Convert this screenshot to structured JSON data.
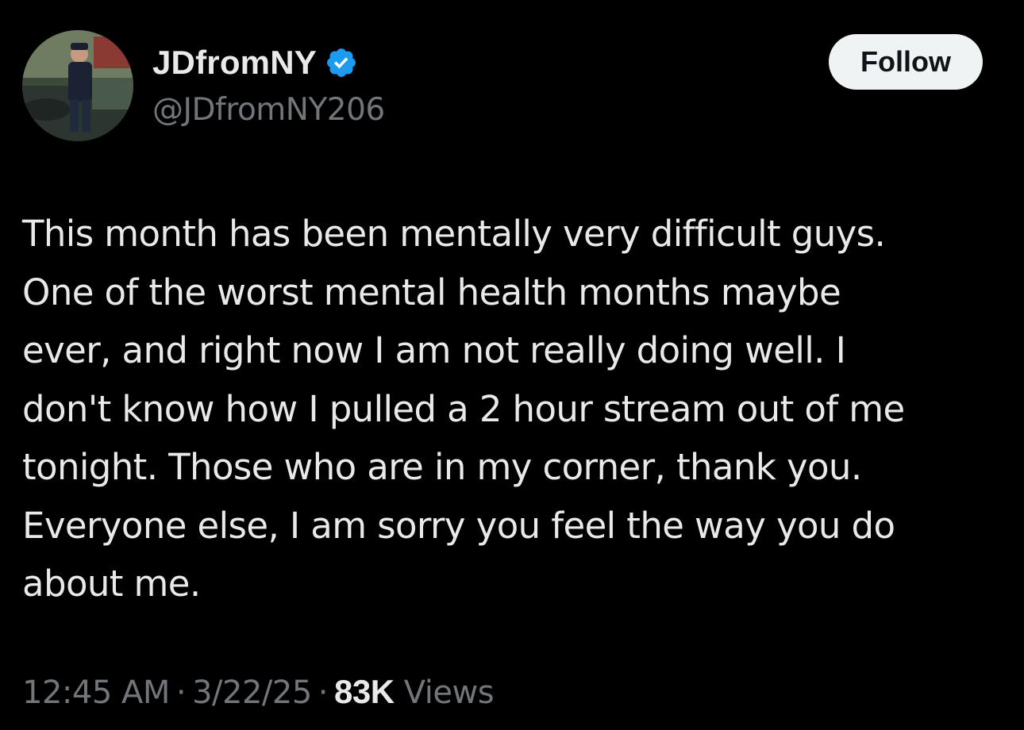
{
  "author": {
    "display_name": "JDfromNY",
    "handle": "@JDfromNY206",
    "verified": true,
    "verified_badge_icon": "verified-badge-icon",
    "avatar_icon": "avatar-photo"
  },
  "actions": {
    "follow_label": "Follow"
  },
  "tweet": {
    "lines": [
      "This month has been mentally very difficult guys.",
      "One of the worst mental health months maybe",
      "ever, and right now I am not really doing well. I",
      "don't know how I pulled a 2 hour stream out of me",
      "tonight. Those who are in my corner, thank you.",
      "Everyone else, I am sorry you feel the way you do",
      "about me."
    ]
  },
  "meta": {
    "time": "12:45 AM",
    "separator": "·",
    "date": "3/22/25",
    "views_count": "83K",
    "views_label": "Views"
  },
  "colors": {
    "background": "#000000",
    "text_primary": "#e7e9ea",
    "text_secondary": "#71767b",
    "verified_blue": "#1d9bf0",
    "follow_bg": "#eff3f4"
  }
}
